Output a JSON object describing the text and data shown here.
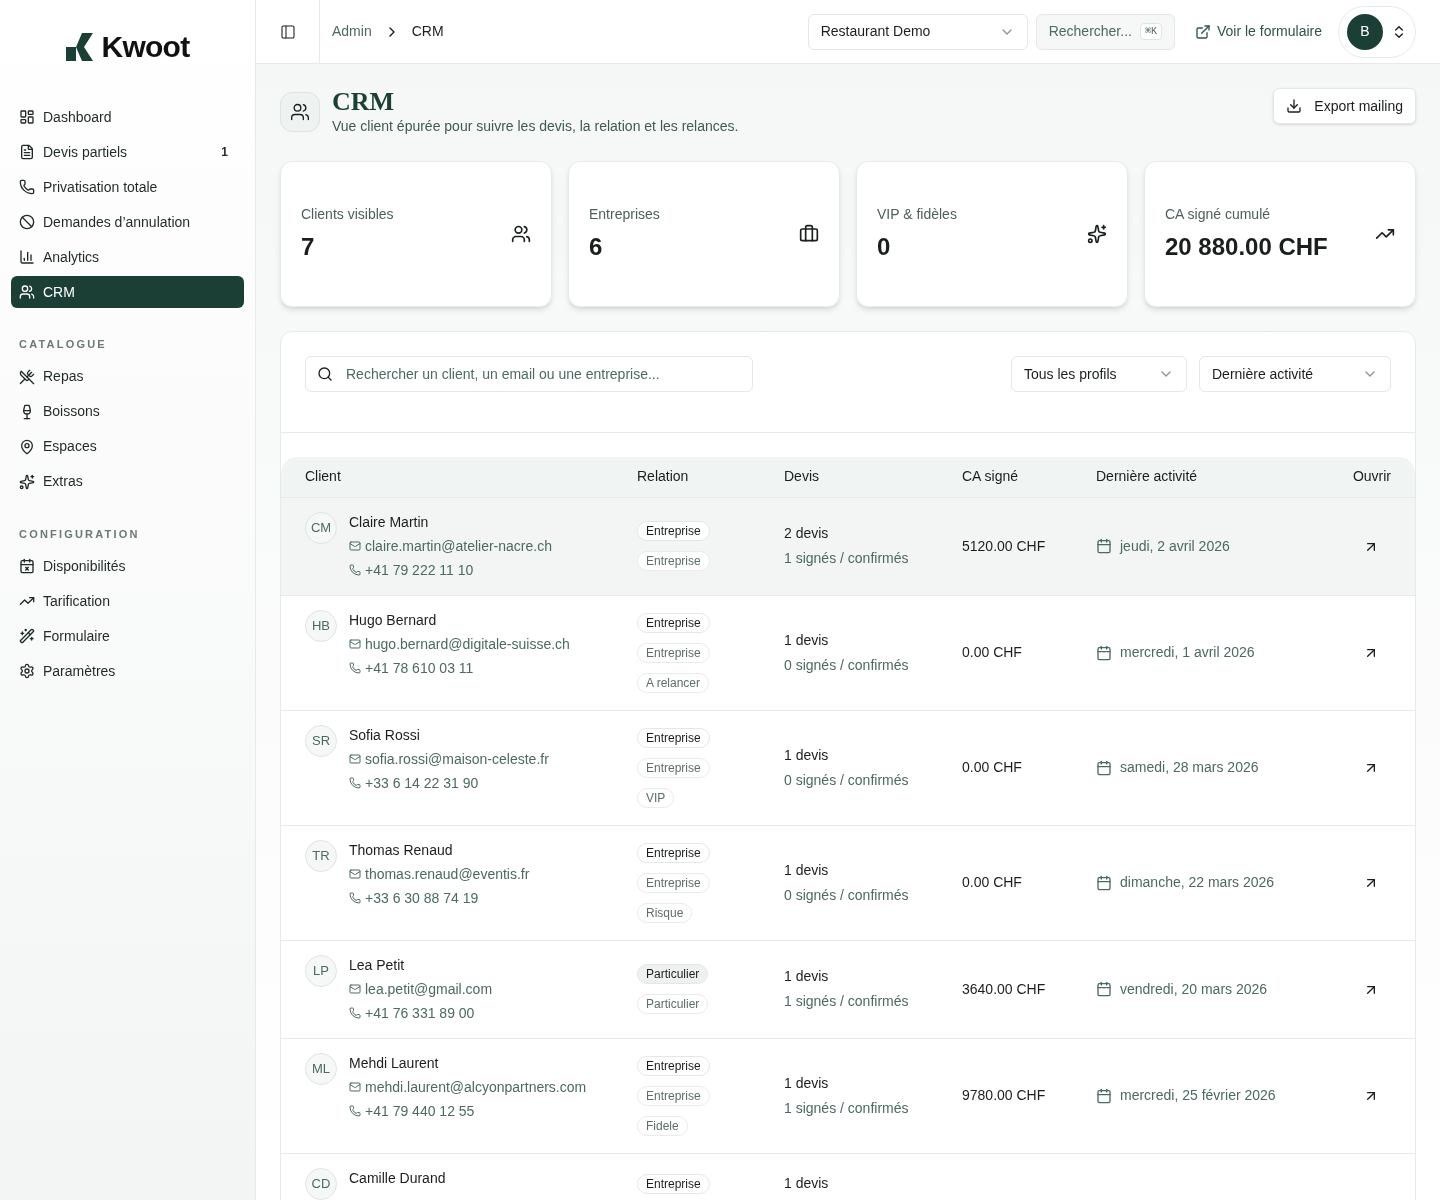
{
  "brand": {
    "name": "Kwoot"
  },
  "sidebar": {
    "items": [
      {
        "label": "Dashboard",
        "selected": false
      },
      {
        "label": "Devis partiels",
        "selected": false,
        "badge": "1"
      },
      {
        "label": "Privatisation totale",
        "selected": false
      },
      {
        "label": "Demandes d’annulation",
        "selected": false
      },
      {
        "label": "Analytics",
        "selected": false
      },
      {
        "label": "CRM",
        "selected": true
      }
    ],
    "sections": [
      {
        "title": "CATALOGUE",
        "items": [
          {
            "label": "Repas",
            "selected": false
          },
          {
            "label": "Boissons",
            "selected": false
          },
          {
            "label": "Espaces",
            "selected": false
          },
          {
            "label": "Extras",
            "selected": false
          }
        ]
      },
      {
        "title": "CONFIGURATION",
        "items": [
          {
            "label": "Disponibilités",
            "selected": false
          },
          {
            "label": "Tarification",
            "selected": false
          },
          {
            "label": "Formulaire",
            "selected": false
          },
          {
            "label": "Paramètres",
            "selected": false
          }
        ]
      }
    ]
  },
  "topbar": {
    "breadcrumb": [
      "Admin",
      "CRM"
    ],
    "restaurant": "Restaurant Demo",
    "search": {
      "placeholder": "Rechercher...",
      "shortcut": "⌘K"
    },
    "form_link": "Voir le formulaire",
    "avatar": "B"
  },
  "page": {
    "title": "CRM",
    "subtitle": "Vue client épurée pour suivre les devis, la relation et les relances.",
    "export_button": "Export mailing"
  },
  "stats": [
    {
      "label": "Clients visibles",
      "value": "7"
    },
    {
      "label": "Entreprises",
      "value": "6"
    },
    {
      "label": "VIP & fidèles",
      "value": "0"
    },
    {
      "label": "CA signé cumulé",
      "value": "20 880.00 CHF"
    }
  ],
  "filters": {
    "search": {
      "placeholder": "Rechercher un client, un email ou une entreprise..."
    },
    "profile": "Tous les profils",
    "sort": "Dernière activité"
  },
  "table": {
    "columns": [
      "Client",
      "Relation",
      "Devis",
      "CA signé",
      "Dernière activité",
      "Ouvrir"
    ],
    "rows": [
      {
        "initials": "CM",
        "name": "Claire Martin",
        "email": "claire.martin@atelier-nacre.ch",
        "phone": "+41 79 222 11 10",
        "selected": true,
        "tags": [
          {
            "label": "Entreprise",
            "kind": "strong"
          },
          {
            "label": "Entreprise",
            "kind": "muted"
          }
        ],
        "devis": "2 devis",
        "signed": "1 signés / confirmés",
        "ca": "5120.00 CHF",
        "date": "jeudi, 2 avril 2026"
      },
      {
        "initials": "HB",
        "name": "Hugo Bernard",
        "email": "hugo.bernard@digitale-suisse.ch",
        "phone": "+41 78 610 03 11",
        "selected": false,
        "tags": [
          {
            "label": "Entreprise",
            "kind": "strong"
          },
          {
            "label": "Entreprise",
            "kind": "muted"
          },
          {
            "label": "A relancer",
            "kind": "muted"
          }
        ],
        "devis": "1 devis",
        "signed": "0 signés / confirmés",
        "ca": "0.00 CHF",
        "date": "mercredi, 1 avril 2026"
      },
      {
        "initials": "SR",
        "name": "Sofia Rossi",
        "email": "sofia.rossi@maison-celeste.fr",
        "phone": "+33 6 14 22 31 90",
        "selected": false,
        "tags": [
          {
            "label": "Entreprise",
            "kind": "strong"
          },
          {
            "label": "Entreprise",
            "kind": "muted"
          },
          {
            "label": "VIP",
            "kind": "muted"
          }
        ],
        "devis": "1 devis",
        "signed": "0 signés / confirmés",
        "ca": "0.00 CHF",
        "date": "samedi, 28 mars 2026"
      },
      {
        "initials": "TR",
        "name": "Thomas Renaud",
        "email": "thomas.renaud@eventis.fr",
        "phone": "+33 6 30 88 74 19",
        "selected": false,
        "tags": [
          {
            "label": "Entreprise",
            "kind": "strong"
          },
          {
            "label": "Entreprise",
            "kind": "muted"
          },
          {
            "label": "Risque",
            "kind": "muted"
          }
        ],
        "devis": "1 devis",
        "signed": "0 signés / confirmés",
        "ca": "0.00 CHF",
        "date": "dimanche, 22 mars 2026"
      },
      {
        "initials": "LP",
        "name": "Lea Petit",
        "email": "lea.petit@gmail.com",
        "phone": "+41 76 331 89 00",
        "selected": false,
        "tags": [
          {
            "label": "Particulier",
            "kind": "filled"
          },
          {
            "label": "Particulier",
            "kind": "muted"
          }
        ],
        "devis": "1 devis",
        "signed": "1 signés / confirmés",
        "ca": "3640.00 CHF",
        "date": "vendredi, 20 mars 2026"
      },
      {
        "initials": "ML",
        "name": "Mehdi Laurent",
        "email": "mehdi.laurent@alcyonpartners.com",
        "phone": "+41 79 440 12 55",
        "selected": false,
        "tags": [
          {
            "label": "Entreprise",
            "kind": "strong"
          },
          {
            "label": "Entreprise",
            "kind": "muted"
          },
          {
            "label": "Fidele",
            "kind": "muted"
          }
        ],
        "devis": "1 devis",
        "signed": "1 signés / confirmés",
        "ca": "9780.00 CHF",
        "date": "mercredi, 25 février 2026"
      },
      {
        "initials": "CD",
        "name": "Camille Durand",
        "selected": false,
        "tags": [
          {
            "label": "Entreprise",
            "kind": "strong"
          }
        ],
        "devis": "1 devis"
      }
    ]
  }
}
